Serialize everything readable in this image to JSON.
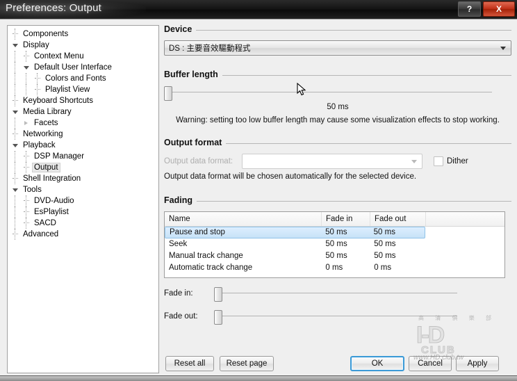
{
  "window": {
    "title": "Preferences: Output",
    "help_button": "?",
    "close_button": "X"
  },
  "sidebar": {
    "items": [
      {
        "label": "Components",
        "depth": 0,
        "marker": "leaf",
        "selected": false
      },
      {
        "label": "Display",
        "depth": 0,
        "marker": "open",
        "selected": false
      },
      {
        "label": "Context Menu",
        "depth": 1,
        "marker": "leaf",
        "selected": false
      },
      {
        "label": "Default User Interface",
        "depth": 1,
        "marker": "open",
        "selected": false
      },
      {
        "label": "Colors and Fonts",
        "depth": 2,
        "marker": "leaf",
        "selected": false
      },
      {
        "label": "Playlist View",
        "depth": 2,
        "marker": "leaf",
        "selected": false
      },
      {
        "label": "Keyboard Shortcuts",
        "depth": 0,
        "marker": "leaf",
        "selected": false
      },
      {
        "label": "Media Library",
        "depth": 0,
        "marker": "open",
        "selected": false
      },
      {
        "label": "Facets",
        "depth": 1,
        "marker": "closed",
        "selected": false
      },
      {
        "label": "Networking",
        "depth": 0,
        "marker": "leaf",
        "selected": false
      },
      {
        "label": "Playback",
        "depth": 0,
        "marker": "open",
        "selected": false
      },
      {
        "label": "DSP Manager",
        "depth": 1,
        "marker": "leaf",
        "selected": false
      },
      {
        "label": "Output",
        "depth": 1,
        "marker": "leaf",
        "selected": true
      },
      {
        "label": "Shell Integration",
        "depth": 0,
        "marker": "leaf",
        "selected": false
      },
      {
        "label": "Tools",
        "depth": 0,
        "marker": "open",
        "selected": false
      },
      {
        "label": "DVD-Audio",
        "depth": 1,
        "marker": "leaf",
        "selected": false
      },
      {
        "label": "EsPlaylist",
        "depth": 1,
        "marker": "leaf",
        "selected": false
      },
      {
        "label": "SACD",
        "depth": 1,
        "marker": "leaf",
        "selected": false
      },
      {
        "label": "Advanced",
        "depth": 0,
        "marker": "leaf",
        "selected": false
      }
    ]
  },
  "device": {
    "group_title": "Device",
    "selected": "DS : 主要音效驅動程式"
  },
  "buffer": {
    "group_title": "Buffer length",
    "value_label": "50 ms",
    "warning": "Warning: setting too low buffer length may cause some visualization effects to stop working.",
    "slider_percent": 0
  },
  "output_format": {
    "group_title": "Output format",
    "field_label": "Output data format:",
    "field_value": "",
    "dither_label": "Dither",
    "dither_checked": false,
    "note": "Output data format will be chosen automatically for the selected device."
  },
  "fading": {
    "group_title": "Fading",
    "columns": [
      "Name",
      "Fade in",
      "Fade out",
      ""
    ],
    "rows": [
      {
        "name": "Pause and stop",
        "fade_in": "50 ms",
        "fade_out": "50 ms",
        "selected": true
      },
      {
        "name": "Seek",
        "fade_in": "50 ms",
        "fade_out": "50 ms",
        "selected": false
      },
      {
        "name": "Manual track change",
        "fade_in": "50 ms",
        "fade_out": "50 ms",
        "selected": false
      },
      {
        "name": "Automatic track change",
        "fade_in": "0 ms",
        "fade_out": "0 ms",
        "selected": false
      }
    ],
    "fade_in_label": "Fade in:",
    "fade_out_label": "Fade out:",
    "fade_in_percent": 0,
    "fade_out_percent": 0
  },
  "buttons": {
    "reset_all": "Reset all",
    "reset_page": "Reset page",
    "ok": "OK",
    "cancel": "Cancel",
    "apply": "Apply"
  },
  "watermark": {
    "logo": "I-D",
    "club": "CLUB",
    "url": "www.HD.club.tw",
    "cjk": "高 清 俱 樂 部"
  },
  "colors": {
    "accent": "#3c9ad6",
    "selection": "#c7e2f7",
    "close_button": "#c03018",
    "titlebar": "#151515"
  }
}
